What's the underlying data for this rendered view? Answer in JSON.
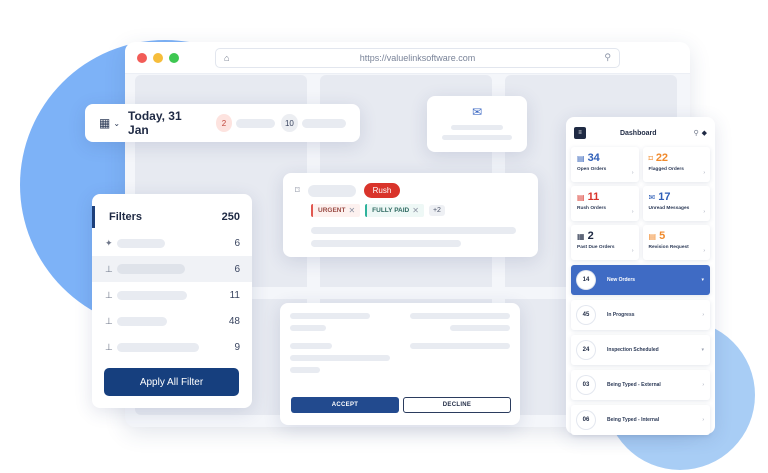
{
  "browser": {
    "url": "https://valuelinksoftware.com",
    "dot_colors": [
      "#f25c57",
      "#f6bd3b",
      "#3ec751"
    ]
  },
  "date_card": {
    "date_label": "Today, 31 Jan",
    "badge_a": "2",
    "badge_b": "10"
  },
  "filters": {
    "title": "Filters",
    "total": "250",
    "rows": [
      {
        "count": "6"
      },
      {
        "count": "6"
      },
      {
        "count": "11"
      },
      {
        "count": "48"
      },
      {
        "count": "9"
      }
    ],
    "apply_label": "Apply All Filter"
  },
  "order_card": {
    "rush_label": "Rush",
    "tags": [
      "URGENT",
      "FULLY PAID"
    ],
    "more": "+2"
  },
  "actions": {
    "accept_label": "ACCEPT",
    "decline_label": "DECLINE"
  },
  "dashboard": {
    "title": "Dashboard",
    "stats": [
      {
        "value": "34",
        "label": "Open Orders",
        "color": "#2f5fb8"
      },
      {
        "value": "22",
        "label": "Flagged Orders",
        "color": "#f08a2c"
      },
      {
        "value": "11",
        "label": "Rush Orders",
        "color": "#d9342b"
      },
      {
        "value": "17",
        "label": "Unread Messages",
        "color": "#2f5fb8"
      },
      {
        "value": "2",
        "label": "Past Due Orders",
        "color": "#1f2a44"
      },
      {
        "value": "5",
        "label": "Revision Request",
        "color": "#f08a2c"
      }
    ],
    "list": [
      {
        "count": "14",
        "label": "New Orders"
      },
      {
        "count": "45",
        "label": "In Progress"
      },
      {
        "count": "24",
        "label": "Inspection Scheduled"
      },
      {
        "count": "03",
        "label": "Being Typed - External"
      },
      {
        "count": "06",
        "label": "Being Typed - Internal"
      }
    ]
  },
  "colors": {
    "primary": "#163f7e",
    "accent_blob": "#7db2f7",
    "rush_red": "#d9342b"
  }
}
